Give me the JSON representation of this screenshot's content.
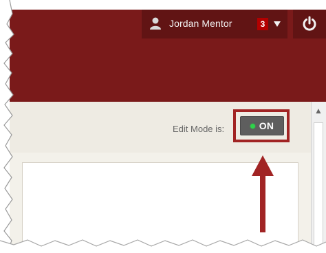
{
  "header": {
    "user_name": "Jordan Mentor",
    "notification_count": "3"
  },
  "edit_mode": {
    "label": "Edit Mode is:",
    "state": "ON"
  },
  "icons": {
    "user": "user-icon",
    "chevron": "chevron-down-icon",
    "power": "power-icon",
    "scroll_up": "scroll-up-icon"
  },
  "colors": {
    "header_bg": "#7a1a1a",
    "header_dark": "#611414",
    "badge": "#b30000",
    "edit_bar": "#eeebe3",
    "on_button": "#5e5e5e",
    "on_indicator": "#2ed34a",
    "annotation": "#a12424"
  }
}
